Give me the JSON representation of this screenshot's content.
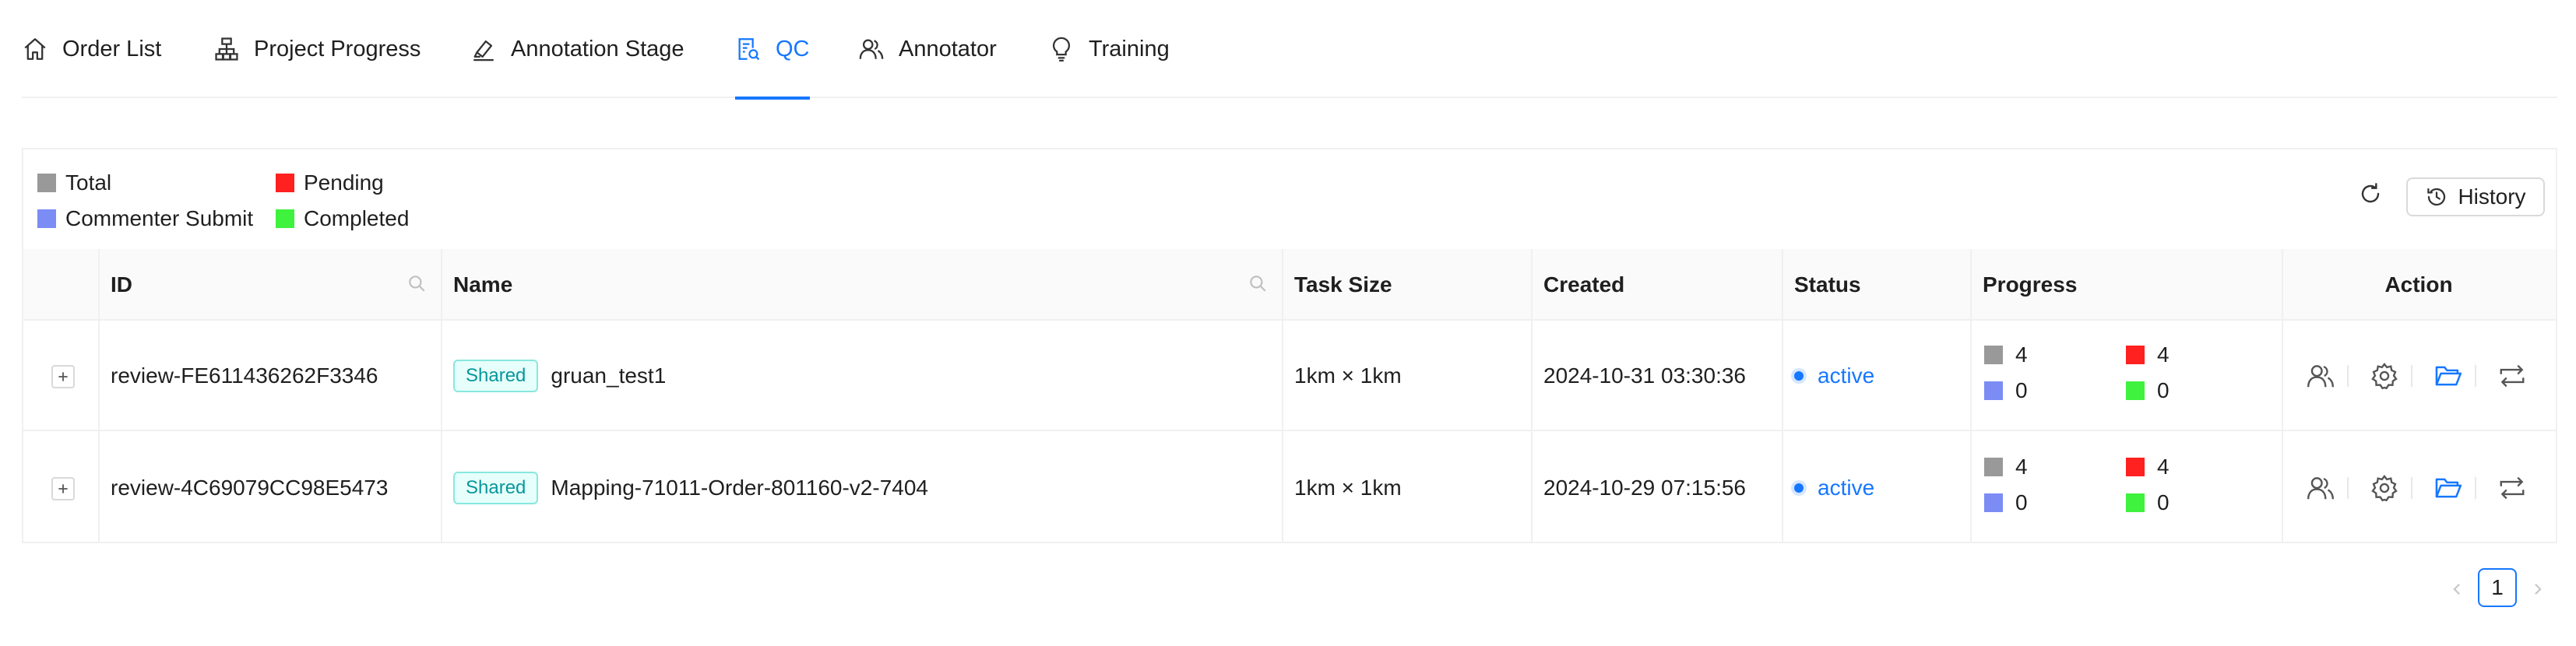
{
  "tabs": [
    {
      "label": "Order List",
      "icon": "home-icon",
      "active": false
    },
    {
      "label": "Project Progress",
      "icon": "org-chart-icon",
      "active": false
    },
    {
      "label": "Annotation Stage",
      "icon": "highlighter-icon",
      "active": false
    },
    {
      "label": "QC",
      "icon": "file-search-icon",
      "active": true
    },
    {
      "label": "Annotator",
      "icon": "users-icon",
      "active": false
    },
    {
      "label": "Training",
      "icon": "bulb-icon",
      "active": false
    }
  ],
  "legend": [
    {
      "label": "Total",
      "color": "#999999"
    },
    {
      "label": "Pending",
      "color": "#ff2020"
    },
    {
      "label": "Commenter Submit",
      "color": "#7b8cf5"
    },
    {
      "label": "Completed",
      "color": "#3ef23e"
    }
  ],
  "toolbar": {
    "refresh_icon": "reload-icon",
    "history_label": "History",
    "history_icon": "clock-history-icon"
  },
  "table": {
    "columns": [
      "ID",
      "Name",
      "Task Size",
      "Created",
      "Status",
      "Progress",
      "Action"
    ],
    "rows": [
      {
        "id": "review-FE611436262F3346",
        "tag": "Shared",
        "name": "gruan_test1",
        "task_size": "1km × 1km",
        "created": "2024-10-31 03:30:36",
        "status": "active",
        "progress": {
          "total": "4",
          "pending": "4",
          "commenter_submit": "0",
          "completed": "0"
        }
      },
      {
        "id": "review-4C69079CC98E5473",
        "tag": "Shared",
        "name": "Mapping-71011-Order-801160-v2-7404",
        "task_size": "1km × 1km",
        "created": "2024-10-29 07:15:56",
        "status": "active",
        "progress": {
          "total": "4",
          "pending": "4",
          "commenter_submit": "0",
          "completed": "0"
        }
      }
    ],
    "action_icons": [
      "assign-user-icon",
      "settings-icon",
      "folder-open-icon",
      "swap-icon"
    ]
  },
  "pagination": {
    "current_page": "1"
  },
  "colors": {
    "accent": "#1677ff",
    "tag_text": "#08979c",
    "tag_bg": "#e6fffb"
  }
}
